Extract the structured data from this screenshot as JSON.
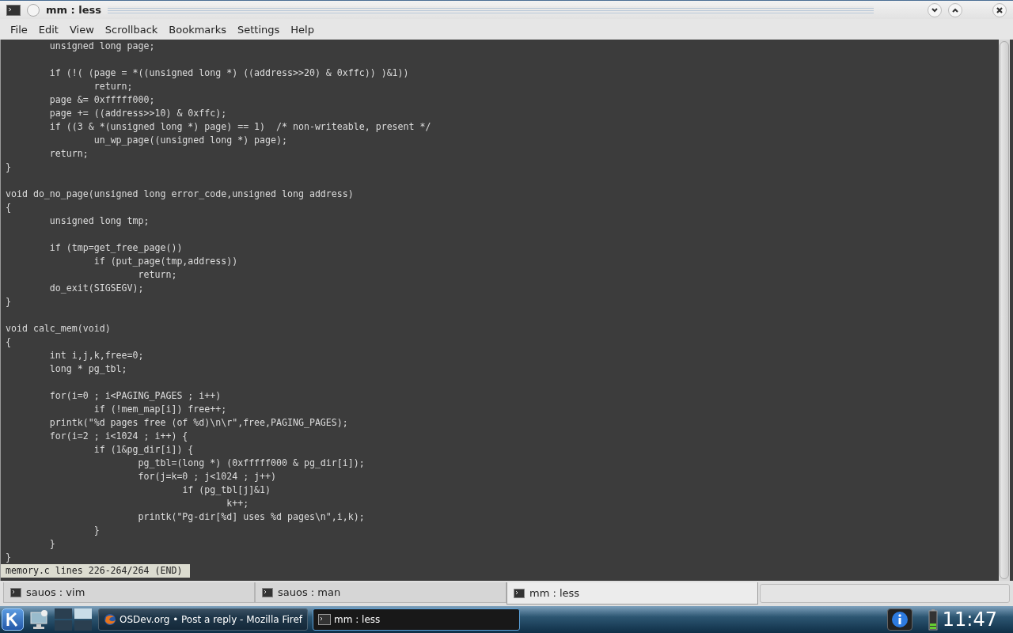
{
  "window": {
    "title": "mm : less"
  },
  "menu": [
    "File",
    "Edit",
    "View",
    "Scrollback",
    "Bookmarks",
    "Settings",
    "Help"
  ],
  "terminal": {
    "blocks": [
      [
        "\tunsigned long page;"
      ],
      [
        "\tif (!( (page = *((unsigned long *) ((address>>20) & 0xffc)) )&1))",
        "\t\treturn;",
        "\tpage &= 0xfffff000;",
        "\tpage += ((address>>10) & 0xffc);",
        "\tif ((3 & *(unsigned long *) page) == 1)  /* non-writeable, present */",
        "\t\tun_wp_page((unsigned long *) page);",
        "\treturn;",
        "}"
      ],
      [
        "void do_no_page(unsigned long error_code,unsigned long address)",
        "{",
        "\tunsigned long tmp;"
      ],
      [
        "\tif (tmp=get_free_page())",
        "\t\tif (put_page(tmp,address))",
        "\t\t\treturn;",
        "\tdo_exit(SIGSEGV);",
        "}"
      ],
      [
        "void calc_mem(void)",
        "{",
        "\tint i,j,k,free=0;",
        "\tlong * pg_tbl;"
      ],
      [
        "\tfor(i=0 ; i<PAGING_PAGES ; i++)",
        "\t\tif (!mem_map[i]) free++;",
        "\tprintk(\"%d pages free (of %d)\\n\\r\",free,PAGING_PAGES);",
        "\tfor(i=2 ; i<1024 ; i++) {",
        "\t\tif (1&pg_dir[i]) {",
        "\t\t\tpg_tbl=(long *) (0xfffff000 & pg_dir[i]);",
        "\t\t\tfor(j=k=0 ; j<1024 ; j++)",
        "\t\t\t\tif (pg_tbl[j]&1)",
        "\t\t\t\t\tk++;",
        "\t\t\tprintk(\"Pg-dir[%d] uses %d pages\\n\",i,k);",
        "\t\t}",
        "\t}",
        "}"
      ]
    ],
    "status": "memory.c lines 226-264/264 (END)"
  },
  "tabs": [
    {
      "label": "sauos : vim",
      "selected": false
    },
    {
      "label": "sauos : man",
      "selected": false
    },
    {
      "label": "mm : less",
      "selected": true
    }
  ],
  "taskbar": {
    "tasks": [
      {
        "label": "OSDev.org • Post a reply - Mozilla Firef",
        "kind": "browser",
        "selected": false
      },
      {
        "label": "mm : less",
        "kind": "terminal",
        "selected": true
      }
    ],
    "clock": "11:47"
  }
}
